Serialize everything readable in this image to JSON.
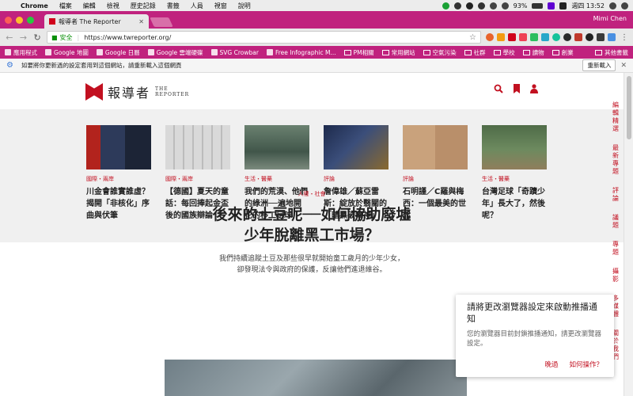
{
  "menubar": {
    "app": "Chrome",
    "items": [
      "檔案",
      "編輯",
      "檢視",
      "歷史記錄",
      "書籤",
      "人員",
      "視窗",
      "說明"
    ],
    "battery": "93%",
    "datetime": "週四 13:52"
  },
  "tab": {
    "title": "報導者 The Reporter"
  },
  "user": "Mimi Chen",
  "omnibox": {
    "secure_label": "安全",
    "url": "https://www.twreporter.org/"
  },
  "bookmarks": {
    "items": [
      "應用程式",
      "Google 地圖",
      "Google 日曆",
      "Google 雲端硬碟",
      "SVG Crowbar",
      "Free Infographic M...",
      "PM相關",
      "常用網站",
      "空氣污染",
      "社群",
      "學校",
      "讀物",
      "創業"
    ],
    "more": "其他書籤"
  },
  "infobar": {
    "message": "如要將你更新過的設定套用到這個網站，請重新載入這個網頁",
    "reload": "重新載入"
  },
  "site": {
    "logo_cn": "報導者",
    "logo_en_1": "THE",
    "logo_en_2": "REPORTER"
  },
  "cards": [
    {
      "tag": "國際・兩岸",
      "title": "川金會誰實誰虛？揭開「非核化」序曲與伏筆"
    },
    {
      "tag": "國際・兩岸",
      "title": "【德國】夏天的童話：每回捧起金盃後的國族辯論"
    },
    {
      "tag": "生活・醫藥",
      "title": "我們的荒漠、他們的綠洲──遍地開花的移工足球"
    },
    {
      "tag": "評論",
      "title": "詹偉雄／蘇亞雷斯：綻放於翳關的「暗黑破壞神」"
    },
    {
      "tag": "評論",
      "title": "石明謹／C羅與梅西：一個最美的世代"
    },
    {
      "tag": "生活・醫藥",
      "title": "台灣足球「奇蹟少年」長大了，然後呢？"
    }
  ],
  "hero": {
    "tag": "人權・社會",
    "title_line1": "後來的土豆呢──如何協助廢墟",
    "title_line2": "少年脫離黑工市場？",
    "desc_line1": "我們持續追蹤土豆及那些很早就開始童工歲月的少年少女，",
    "desc_line2": "卻發現法令與政府的保護，反讓他們進退維谷。"
  },
  "sidenav": [
    "編輯精選",
    "最新專題",
    "評論",
    "議題",
    "專題",
    "攝影",
    "多媒體",
    "關於我們"
  ],
  "notification": {
    "title": "請將更改瀏覽器設定來啟動推播通知",
    "body": "您的瀏覽器目前封鎖推播通知，請更改瀏覽器設定。",
    "later": "晚過",
    "how": "如何操作？"
  },
  "colors": {
    "brand": "#c21020",
    "chrome_theme": "#c0227e"
  }
}
